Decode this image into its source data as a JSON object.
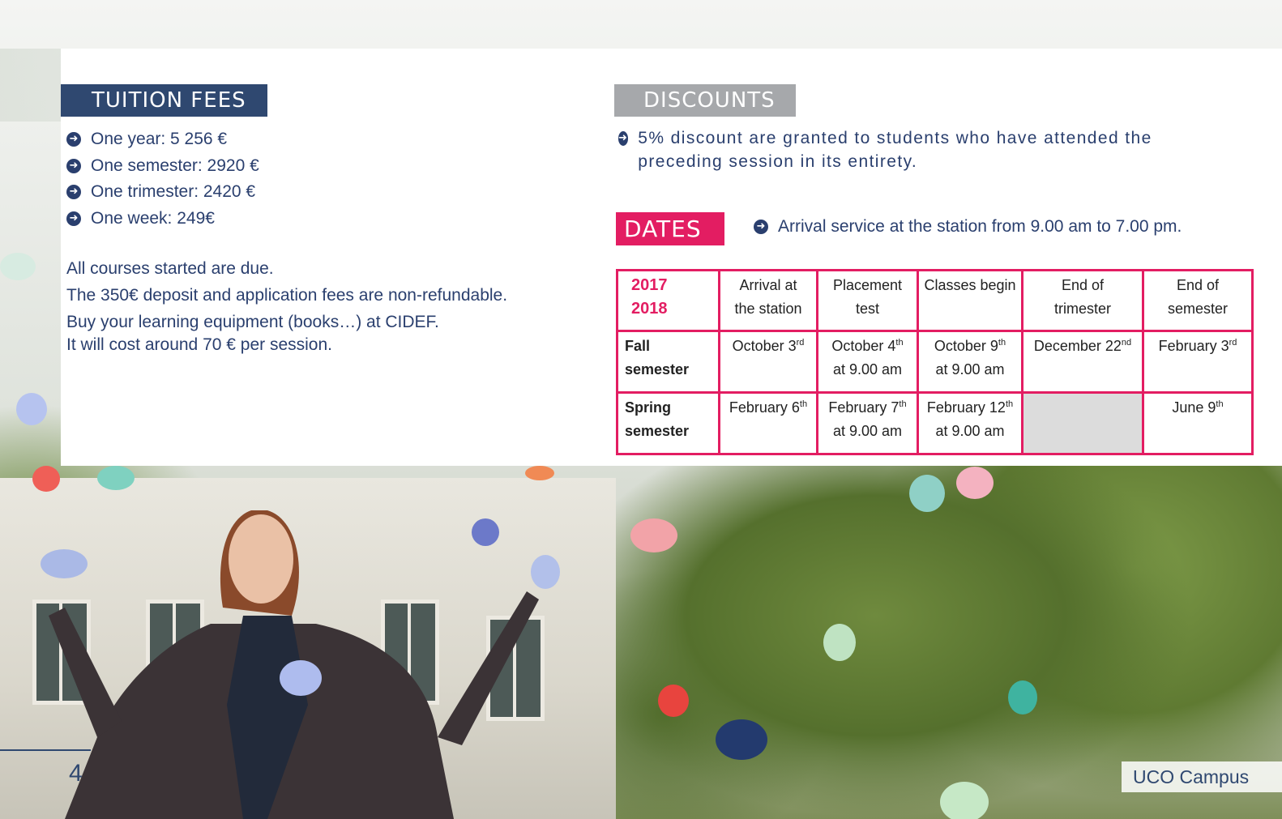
{
  "tuition": {
    "title": "TUITION FEES",
    "items": [
      "One year: 5 256 €",
      "One semester: 2920 €",
      "One trimester: 2420 €",
      "One week: 249€"
    ],
    "notes": [
      "All courses started are due.",
      "The 350€ deposit and application fees are non-refundable.",
      "Buy your learning equipment (books…) at CIDEF.",
      "It will cost around 70 € per session."
    ]
  },
  "discounts": {
    "title": "DISCOUNTS",
    "text": "5% discount are granted to students who have attended the preceding session in its entirety."
  },
  "dates": {
    "title": "DATES",
    "arrival_note": "Arrival service at the station from 9.00 am to 7.00 pm.",
    "year_top": "2017",
    "year_bottom": "2018",
    "columns": [
      {
        "l1": "Arrival at",
        "l2": "the station"
      },
      {
        "l1": "Placement",
        "l2": "test"
      },
      {
        "l1": "Classes begin",
        "l2": ""
      },
      {
        "l1": "End of",
        "l2": "trimester"
      },
      {
        "l1": "End of",
        "l2": "semester"
      }
    ],
    "rows": [
      {
        "l1": "Fall",
        "l2": "semester",
        "cells": [
          {
            "main": "October 3",
            "sup": "rd",
            "l2": ""
          },
          {
            "main": "October 4",
            "sup": "th",
            "l2": "at 9.00 am"
          },
          {
            "main": "October 9",
            "sup": "th",
            "l2": "at 9.00 am"
          },
          {
            "main": "December 22",
            "sup": "nd",
            "l2": ""
          },
          {
            "main": "February 3",
            "sup": "rd",
            "l2": ""
          }
        ]
      },
      {
        "l1": "Spring",
        "l2": "semester",
        "cells": [
          {
            "main": "February 6",
            "sup": "th",
            "l2": ""
          },
          {
            "main": "February 7",
            "sup": "th",
            "l2": "at 9.00 am"
          },
          {
            "main": "February 12",
            "sup": "th",
            "l2": "at 9.00 am"
          },
          {
            "main": "",
            "sup": "",
            "l2": ""
          },
          {
            "main": "June 9",
            "sup": "th",
            "l2": ""
          }
        ]
      }
    ]
  },
  "footer": {
    "page_number": "4",
    "campus_label": "UCO Campus"
  },
  "colors": {
    "navy": "#2f4870",
    "pink": "#e31d62",
    "grey": "#a6a8ab"
  }
}
